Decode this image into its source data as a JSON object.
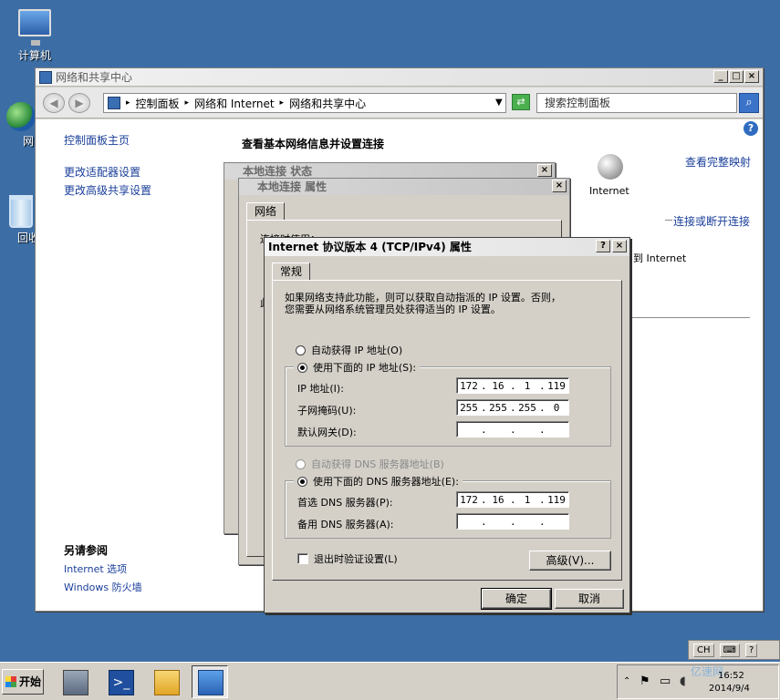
{
  "desktop": {
    "computer": "计算机",
    "network_partial": "网",
    "recycle_partial": "回收"
  },
  "window": {
    "title": "网络和共享中心",
    "controls": {
      "minimize": "_",
      "maximize": "□",
      "close": "×"
    },
    "breadcrumb": [
      "控制面板",
      "网络和 Internet",
      "网络和共享中心"
    ],
    "search_placeholder": "搜索控制面板",
    "help": "?"
  },
  "sidebar": {
    "home": "控制面板主页",
    "links": [
      "更改适配器设置",
      "更改高级共享设置"
    ],
    "see_also_title": "另请参阅",
    "see_also": [
      "Internet 选项",
      "Windows 防火墙"
    ]
  },
  "main": {
    "title": "查看基本网络信息并设置连接",
    "full_map": "查看完整映射",
    "internet_label": "Internet",
    "connect_link": "连接或断开连接",
    "access_internet": "到 Internet"
  },
  "status_dialog": {
    "title": "本地连接 状态",
    "close": "×"
  },
  "props_dialog": {
    "title": "本地连接 属性",
    "close": "×",
    "tab": "网络",
    "connect_using_partial": "连接时使用：",
    "item_partial": "此"
  },
  "ipv4_dialog": {
    "title": "Internet 协议版本 4 (TCP/IPv4) 属性",
    "help_btn": "?",
    "close_btn": "×",
    "tab": "常规",
    "description_line1": "如果网络支持此功能，则可以获取自动指派的 IP 设置。否则，",
    "description_line2": "您需要从网络系统管理员处获得适当的 IP 设置。",
    "auto_ip": "自动获得 IP 地址(O)",
    "use_ip": "使用下面的 IP 地址(S):",
    "ip_label": "IP 地址(I):",
    "mask_label": "子网掩码(U):",
    "gateway_label": "默认网关(D):",
    "ip_value": [
      "172",
      "16",
      "1",
      "119"
    ],
    "mask_value": [
      "255",
      "255",
      "255",
      "0"
    ],
    "gateway_value": [
      "",
      "",
      "",
      ""
    ],
    "auto_dns": "自动获得 DNS 服务器地址(B)",
    "use_dns": "使用下面的 DNS 服务器地址(E):",
    "pref_dns_label": "首选 DNS 服务器(P):",
    "alt_dns_label": "备用 DNS 服务器(A):",
    "pref_dns_value": [
      "172",
      "16",
      "1",
      "119"
    ],
    "alt_dns_value": [
      "",
      "",
      "",
      ""
    ],
    "validate": "退出时验证设置(L)",
    "advanced": "高级(V)...",
    "ok": "确定",
    "cancel": "取消"
  },
  "taskbar": {
    "start": "开始",
    "lang": "CH",
    "help": "?",
    "clock_time": "16:52",
    "clock_date": "2014/9/4",
    "watermark": "亿速网"
  }
}
